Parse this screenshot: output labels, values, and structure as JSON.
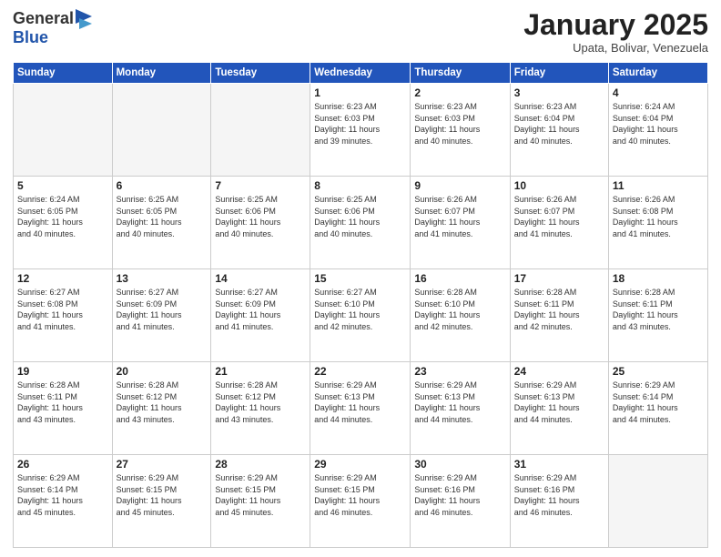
{
  "header": {
    "logo_general": "General",
    "logo_blue": "Blue",
    "month_title": "January 2025",
    "location": "Upata, Bolivar, Venezuela"
  },
  "days_of_week": [
    "Sunday",
    "Monday",
    "Tuesday",
    "Wednesday",
    "Thursday",
    "Friday",
    "Saturday"
  ],
  "weeks": [
    [
      {
        "day": "",
        "info": ""
      },
      {
        "day": "",
        "info": ""
      },
      {
        "day": "",
        "info": ""
      },
      {
        "day": "1",
        "info": "Sunrise: 6:23 AM\nSunset: 6:03 PM\nDaylight: 11 hours\nand 39 minutes."
      },
      {
        "day": "2",
        "info": "Sunrise: 6:23 AM\nSunset: 6:03 PM\nDaylight: 11 hours\nand 40 minutes."
      },
      {
        "day": "3",
        "info": "Sunrise: 6:23 AM\nSunset: 6:04 PM\nDaylight: 11 hours\nand 40 minutes."
      },
      {
        "day": "4",
        "info": "Sunrise: 6:24 AM\nSunset: 6:04 PM\nDaylight: 11 hours\nand 40 minutes."
      }
    ],
    [
      {
        "day": "5",
        "info": "Sunrise: 6:24 AM\nSunset: 6:05 PM\nDaylight: 11 hours\nand 40 minutes."
      },
      {
        "day": "6",
        "info": "Sunrise: 6:25 AM\nSunset: 6:05 PM\nDaylight: 11 hours\nand 40 minutes."
      },
      {
        "day": "7",
        "info": "Sunrise: 6:25 AM\nSunset: 6:06 PM\nDaylight: 11 hours\nand 40 minutes."
      },
      {
        "day": "8",
        "info": "Sunrise: 6:25 AM\nSunset: 6:06 PM\nDaylight: 11 hours\nand 40 minutes."
      },
      {
        "day": "9",
        "info": "Sunrise: 6:26 AM\nSunset: 6:07 PM\nDaylight: 11 hours\nand 41 minutes."
      },
      {
        "day": "10",
        "info": "Sunrise: 6:26 AM\nSunset: 6:07 PM\nDaylight: 11 hours\nand 41 minutes."
      },
      {
        "day": "11",
        "info": "Sunrise: 6:26 AM\nSunset: 6:08 PM\nDaylight: 11 hours\nand 41 minutes."
      }
    ],
    [
      {
        "day": "12",
        "info": "Sunrise: 6:27 AM\nSunset: 6:08 PM\nDaylight: 11 hours\nand 41 minutes."
      },
      {
        "day": "13",
        "info": "Sunrise: 6:27 AM\nSunset: 6:09 PM\nDaylight: 11 hours\nand 41 minutes."
      },
      {
        "day": "14",
        "info": "Sunrise: 6:27 AM\nSunset: 6:09 PM\nDaylight: 11 hours\nand 41 minutes."
      },
      {
        "day": "15",
        "info": "Sunrise: 6:27 AM\nSunset: 6:10 PM\nDaylight: 11 hours\nand 42 minutes."
      },
      {
        "day": "16",
        "info": "Sunrise: 6:28 AM\nSunset: 6:10 PM\nDaylight: 11 hours\nand 42 minutes."
      },
      {
        "day": "17",
        "info": "Sunrise: 6:28 AM\nSunset: 6:11 PM\nDaylight: 11 hours\nand 42 minutes."
      },
      {
        "day": "18",
        "info": "Sunrise: 6:28 AM\nSunset: 6:11 PM\nDaylight: 11 hours\nand 43 minutes."
      }
    ],
    [
      {
        "day": "19",
        "info": "Sunrise: 6:28 AM\nSunset: 6:11 PM\nDaylight: 11 hours\nand 43 minutes."
      },
      {
        "day": "20",
        "info": "Sunrise: 6:28 AM\nSunset: 6:12 PM\nDaylight: 11 hours\nand 43 minutes."
      },
      {
        "day": "21",
        "info": "Sunrise: 6:28 AM\nSunset: 6:12 PM\nDaylight: 11 hours\nand 43 minutes."
      },
      {
        "day": "22",
        "info": "Sunrise: 6:29 AM\nSunset: 6:13 PM\nDaylight: 11 hours\nand 44 minutes."
      },
      {
        "day": "23",
        "info": "Sunrise: 6:29 AM\nSunset: 6:13 PM\nDaylight: 11 hours\nand 44 minutes."
      },
      {
        "day": "24",
        "info": "Sunrise: 6:29 AM\nSunset: 6:13 PM\nDaylight: 11 hours\nand 44 minutes."
      },
      {
        "day": "25",
        "info": "Sunrise: 6:29 AM\nSunset: 6:14 PM\nDaylight: 11 hours\nand 44 minutes."
      }
    ],
    [
      {
        "day": "26",
        "info": "Sunrise: 6:29 AM\nSunset: 6:14 PM\nDaylight: 11 hours\nand 45 minutes."
      },
      {
        "day": "27",
        "info": "Sunrise: 6:29 AM\nSunset: 6:15 PM\nDaylight: 11 hours\nand 45 minutes."
      },
      {
        "day": "28",
        "info": "Sunrise: 6:29 AM\nSunset: 6:15 PM\nDaylight: 11 hours\nand 45 minutes."
      },
      {
        "day": "29",
        "info": "Sunrise: 6:29 AM\nSunset: 6:15 PM\nDaylight: 11 hours\nand 46 minutes."
      },
      {
        "day": "30",
        "info": "Sunrise: 6:29 AM\nSunset: 6:16 PM\nDaylight: 11 hours\nand 46 minutes."
      },
      {
        "day": "31",
        "info": "Sunrise: 6:29 AM\nSunset: 6:16 PM\nDaylight: 11 hours\nand 46 minutes."
      },
      {
        "day": "",
        "info": ""
      }
    ]
  ]
}
